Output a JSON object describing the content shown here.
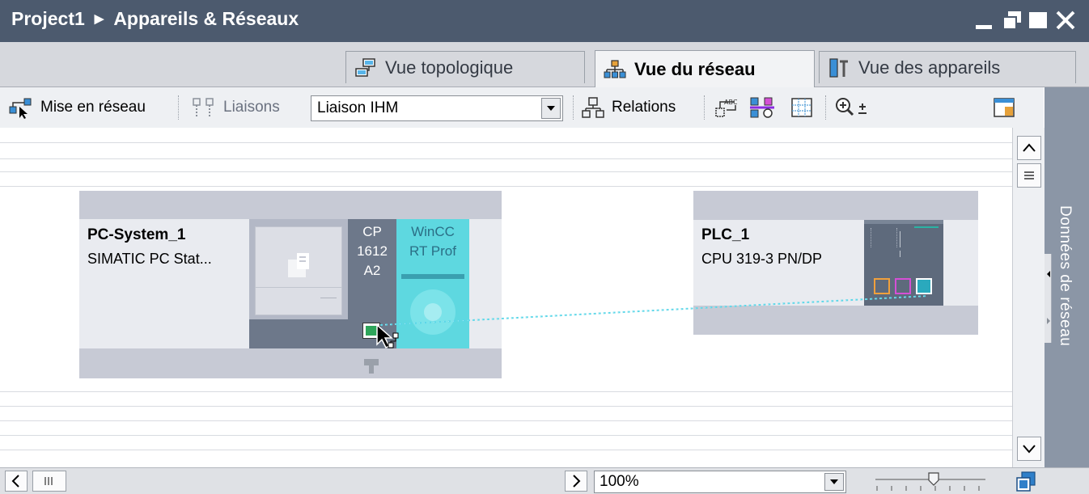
{
  "titlebar": {
    "project": "Project1",
    "view": "Appareils & Réseaux"
  },
  "tabs": [
    {
      "label": "Vue topologique",
      "icon": "topology-icon",
      "active": false
    },
    {
      "label": "Vue du réseau",
      "icon": "network-icon",
      "active": true
    },
    {
      "label": "Vue des appareils",
      "icon": "devices-icon",
      "active": false
    }
  ],
  "toolbar": {
    "networking_label": "Mise en réseau",
    "connections_label": "Liaisons",
    "connection_type": "Liaison IHM",
    "relations_label": "Relations"
  },
  "devices": {
    "pc": {
      "name": "PC-System_1",
      "type": "SIMATIC PC Stat...",
      "cp_module": [
        "CP",
        "1612",
        "A2"
      ],
      "winc_module": [
        "WinCC",
        "RT Prof"
      ]
    },
    "plc": {
      "name": "PLC_1",
      "type": "CPU 319-3 PN/DP"
    }
  },
  "sidepanel": {
    "label": "Données de réseau"
  },
  "bottombar": {
    "zoom": "100%"
  },
  "colors": {
    "titlebar": "#4c5a6e",
    "network_line": "#59d6e8",
    "port_green": "#2ea55a",
    "port_orange": "#f0a03c",
    "port_magenta": "#d54fd6",
    "winc_cyan": "#5ed8e0"
  }
}
